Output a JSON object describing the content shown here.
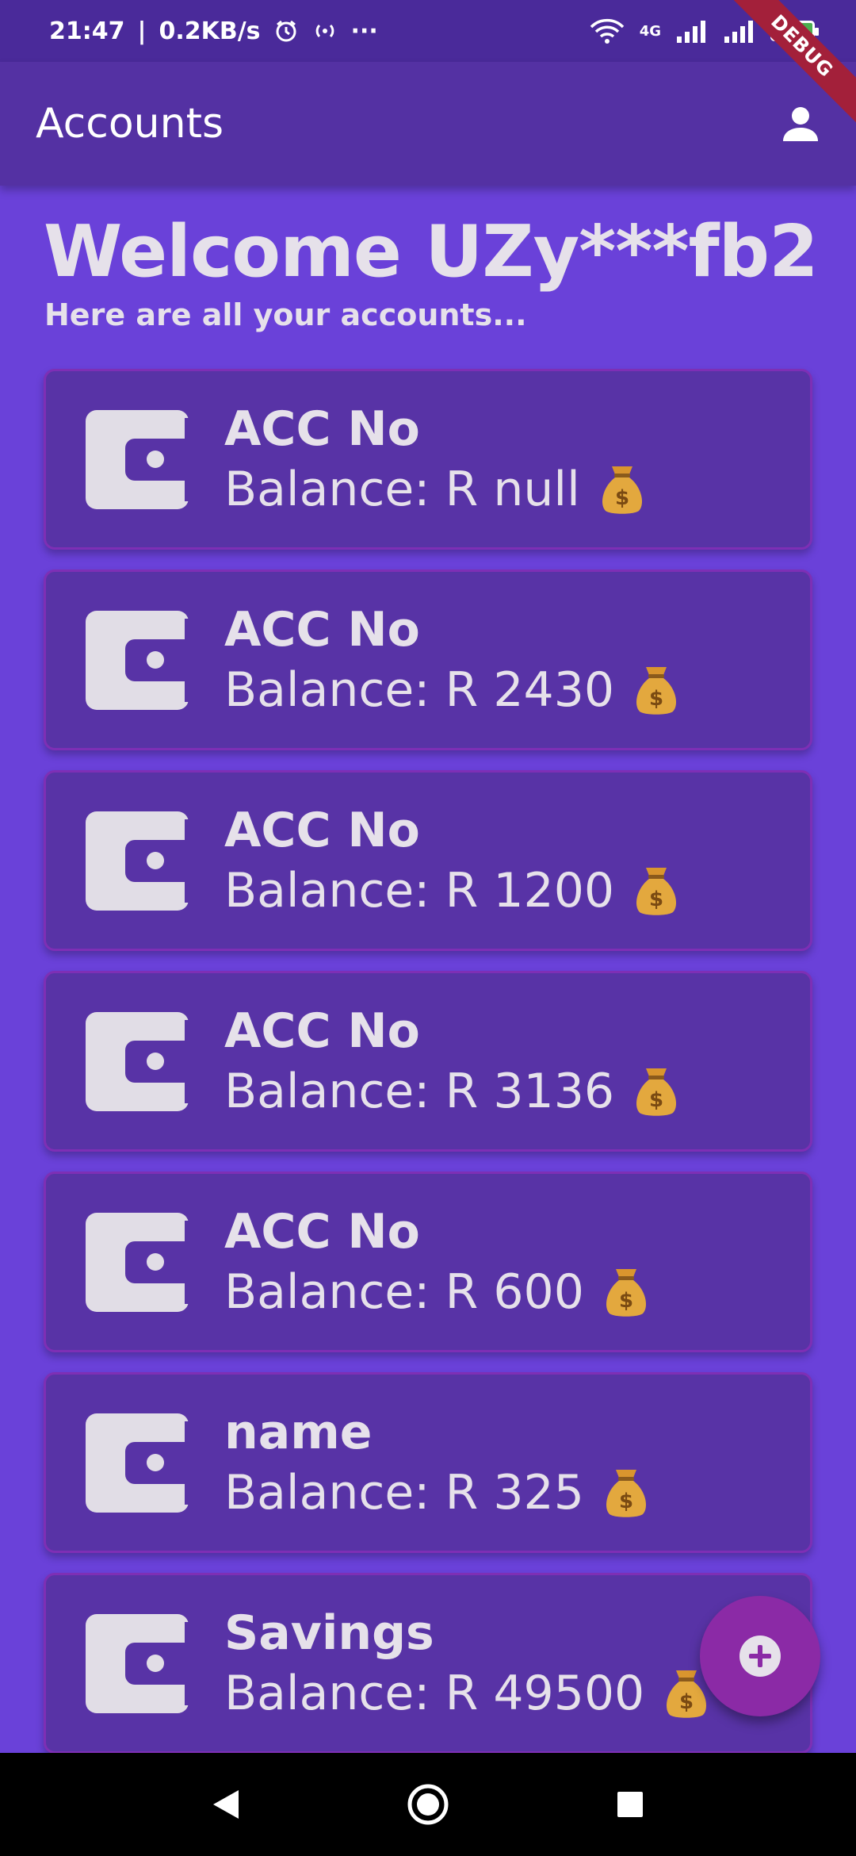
{
  "status_bar": {
    "time": "21:47",
    "network_speed": "0.2KB/s",
    "separator": "|",
    "more": "···",
    "network_type": "4G",
    "battery": "100"
  },
  "debug_banner": "DEBUG",
  "app_bar": {
    "title": "Accounts",
    "profile_icon": "person-icon"
  },
  "header": {
    "welcome": "Welcome UZy***fb2",
    "subtitle": "Here are all your accounts..."
  },
  "accounts": [
    {
      "name": "ACC No",
      "balance": "Balance: R null"
    },
    {
      "name": "ACC No",
      "balance": "Balance: R 2430"
    },
    {
      "name": "ACC No",
      "balance": "Balance: R 1200"
    },
    {
      "name": "ACC No",
      "balance": "Balance: R 3136"
    },
    {
      "name": "ACC No",
      "balance": "Balance: R 600"
    },
    {
      "name": "name",
      "balance": "Balance: R 325"
    },
    {
      "name": "Savings",
      "balance": "Balance: R 49500"
    }
  ],
  "icons": {
    "wallet": "wallet-icon",
    "money_bag": "money-bag-icon",
    "fab": "add-icon"
  },
  "colors": {
    "background": "#6a41d9",
    "app_bar": "#5431a3",
    "card": "#5833a6",
    "card_border": "#7e2fb5",
    "fab": "#8b2aa6",
    "text": "#e6e1ea"
  }
}
